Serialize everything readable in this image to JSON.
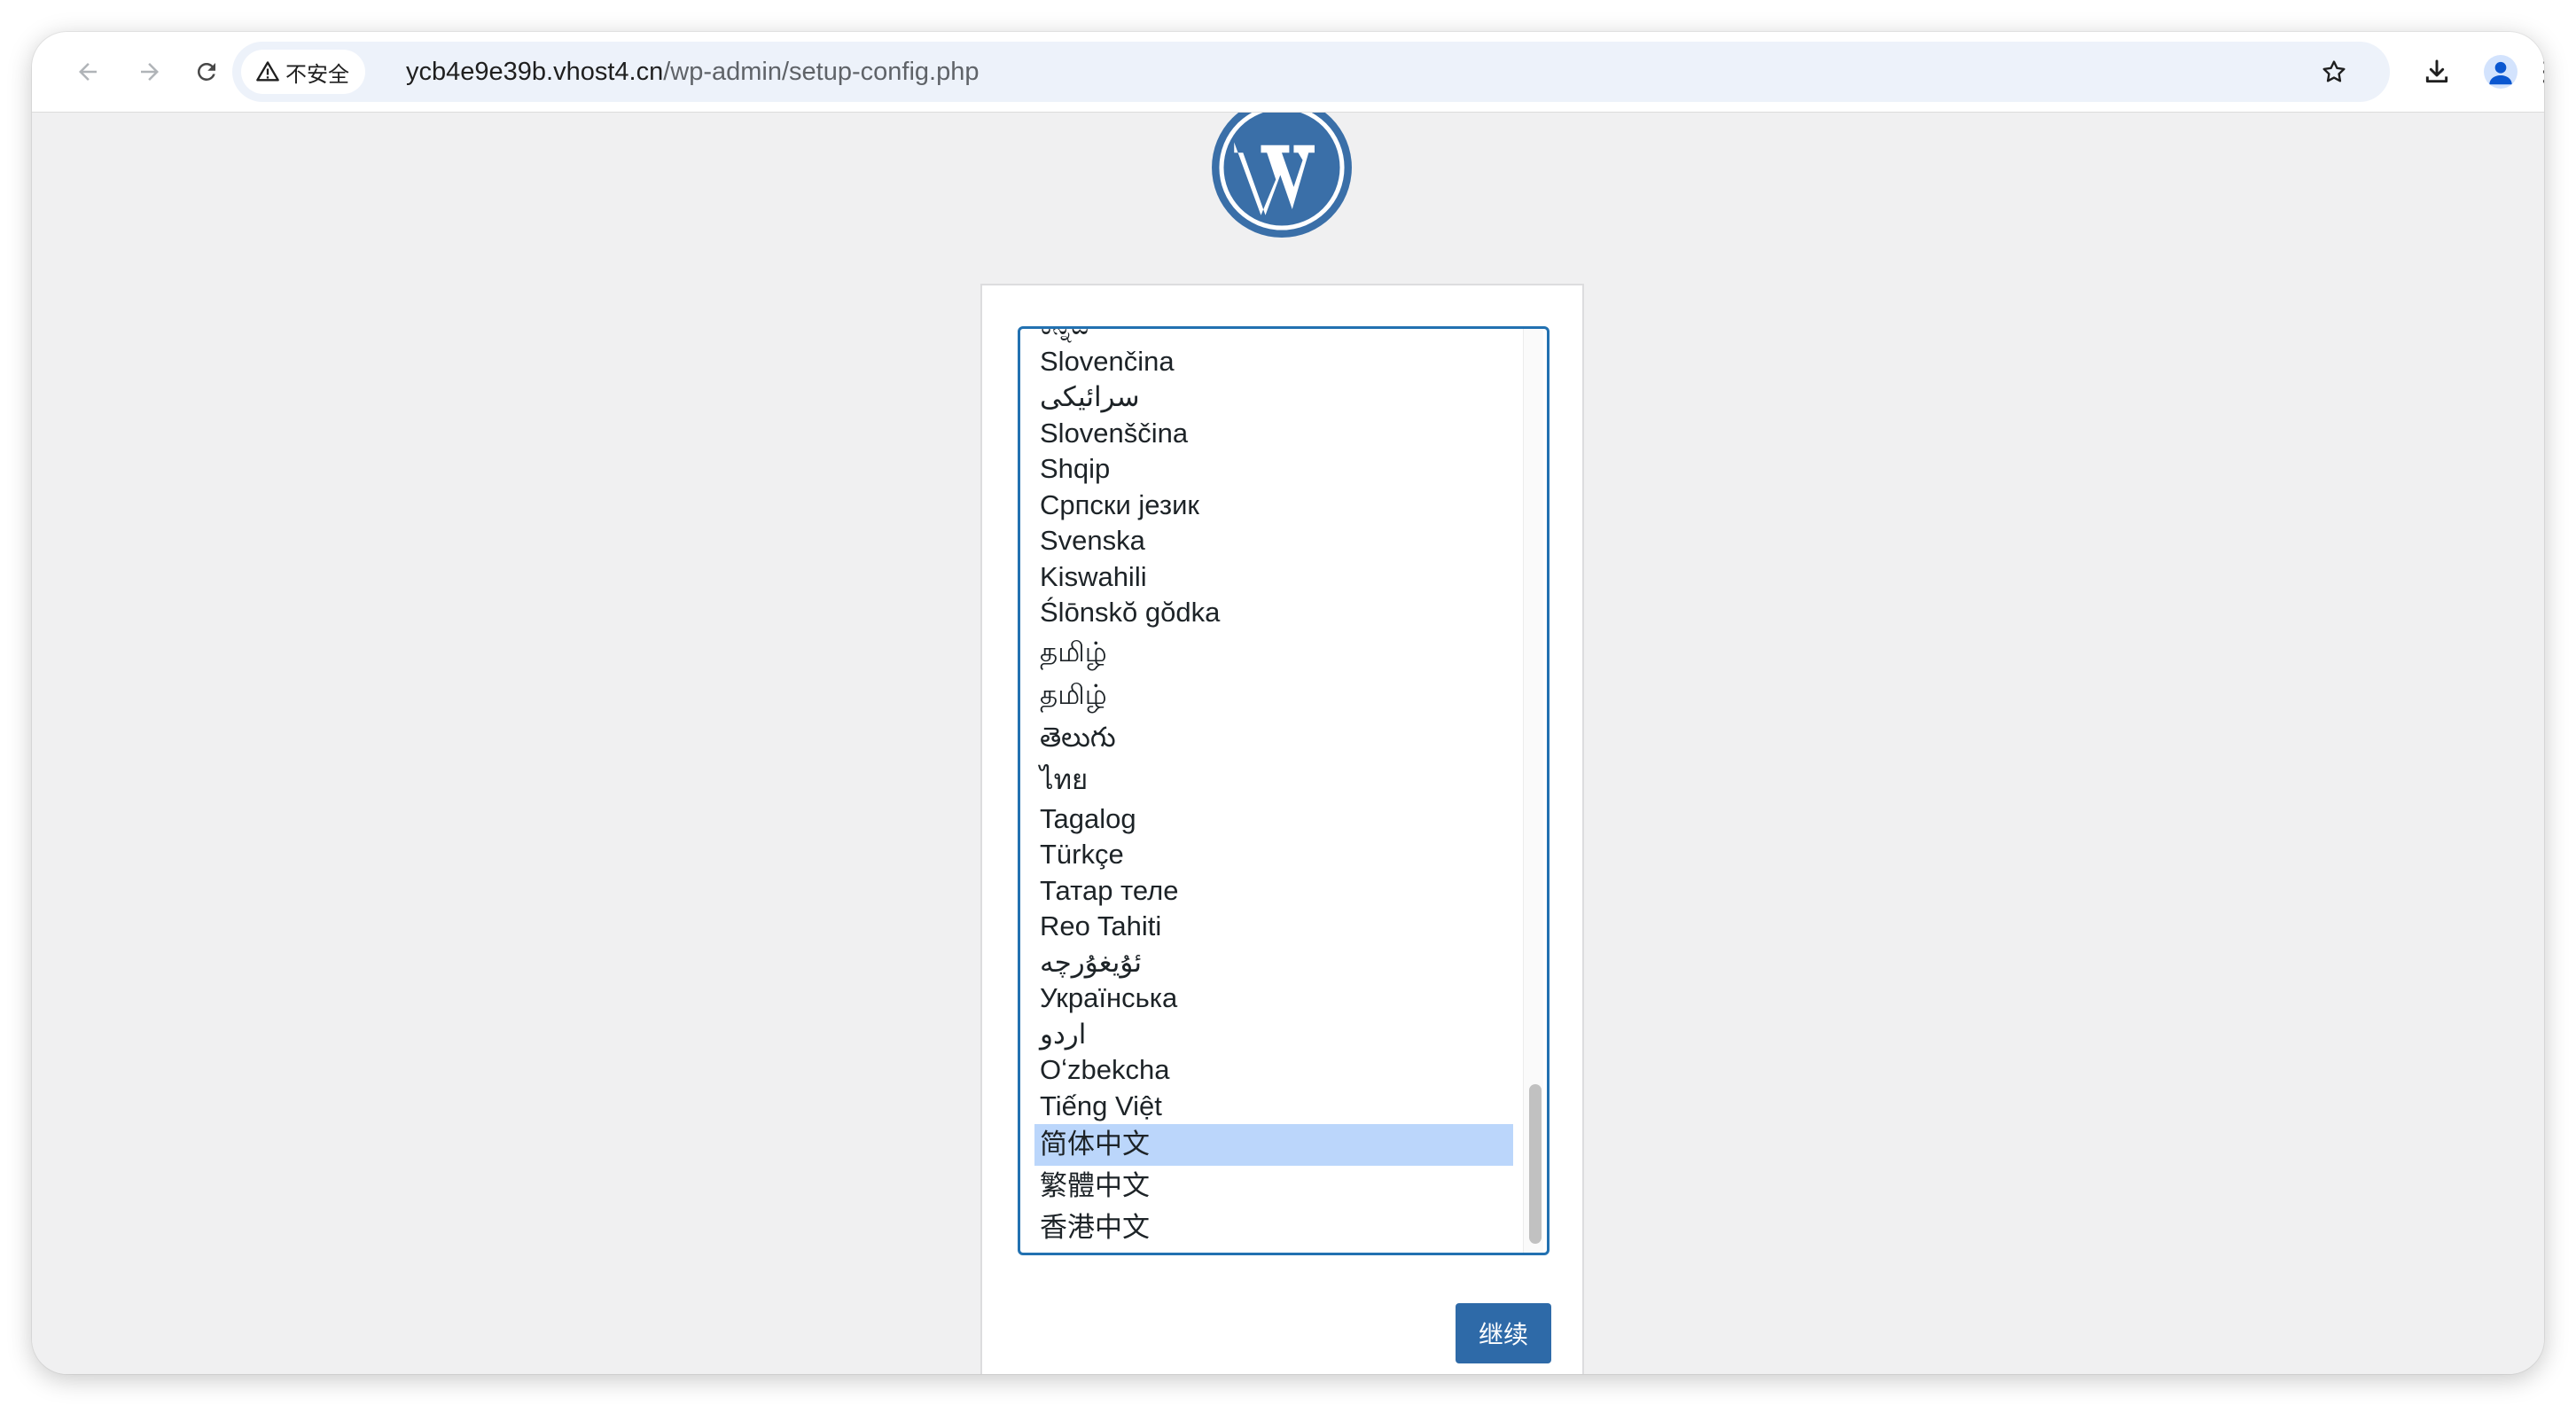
{
  "browser": {
    "security_label": "不安全",
    "url_host": "ycb4e9e39b.vhost4.cn",
    "url_path": "/wp-admin/setup-config.php"
  },
  "setup": {
    "languages": [
      "ಕನ್ನಡ",
      "Slovenčina",
      "سرائیکی",
      "Slovenščina",
      "Shqip",
      "Српски језик",
      "Svenska",
      "Kiswahili",
      "Ślōnskŏ gŏdka",
      "தமிழ்",
      "தமிழ்",
      "తెలుగు",
      "ไทย",
      "Tagalog",
      "Türkçe",
      "Татар теле",
      "Reo Tahiti",
      "ئۇيغۇرچە",
      "Українська",
      "اردو",
      "Oʻzbekcha",
      "Tiếng Việt",
      "简体中文",
      "繁體中文",
      "香港中文"
    ],
    "selected_language": "简体中文",
    "continue_label": "继续"
  },
  "colors": {
    "accent": "#2271b1",
    "button": "#2e6aa8",
    "selection": "#bbd6fb",
    "page_bg": "#f0f0f1"
  }
}
